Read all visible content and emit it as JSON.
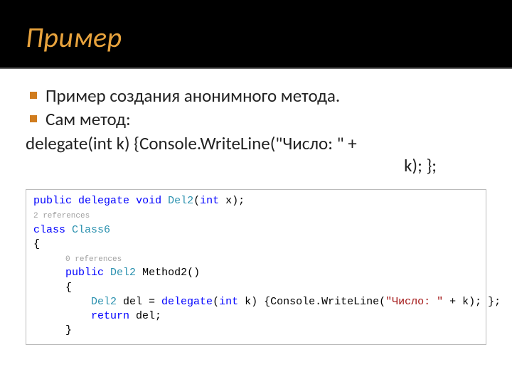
{
  "header": {
    "title": "Пример"
  },
  "bullets": {
    "b1": "Пример создания анонимного метода.",
    "b2": "Сам метод:"
  },
  "snippet": {
    "line1": "delegate(int k) {Console.WriteLine(\"Число: \" +",
    "line2": "k); };"
  },
  "code": {
    "kw_public": "public",
    "kw_delegate": "delegate",
    "kw_void": "void",
    "typ_del2": "Del2",
    "kw_int": "int",
    "param_x": " x);",
    "open_paren": "(",
    "ref2": "2 references",
    "kw_class": "class",
    "typ_class6": "Class6",
    "brace_open": "{",
    "ref0": "0 references",
    "method_name": " Method2()",
    "del_var": " del = ",
    "param_k": " k) {Console.WriteLine(",
    "str_num": "\"Число: \"",
    "tail": " + k); };",
    "kw_return": "return",
    "return_tail": " del;",
    "brace_close": "}"
  }
}
